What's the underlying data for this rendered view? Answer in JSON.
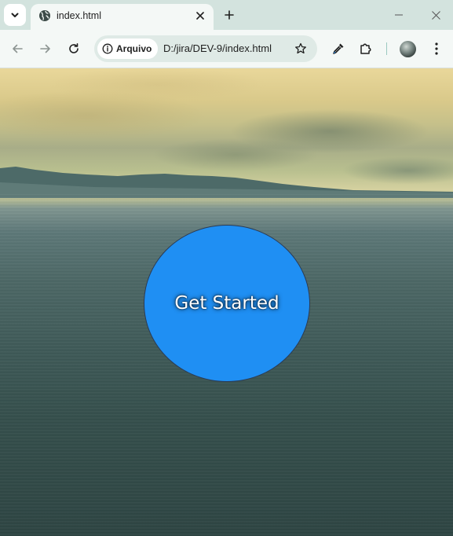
{
  "browser": {
    "tab": {
      "title": "index.html",
      "favicon": "globe-icon"
    },
    "toolbar": {
      "security_chip_label": "Arquivo",
      "url": "D:/jira/DEV-9/index.html"
    },
    "colors": {
      "frame": "#d3e3de",
      "toolbar": "#f4f8f6",
      "omnibox": "#dfeae6",
      "separator": "#9bc9c0"
    }
  },
  "page": {
    "cta_label": "Get Started",
    "cta_color": "#1f8ff3",
    "background": "sea-landscape-photo"
  }
}
